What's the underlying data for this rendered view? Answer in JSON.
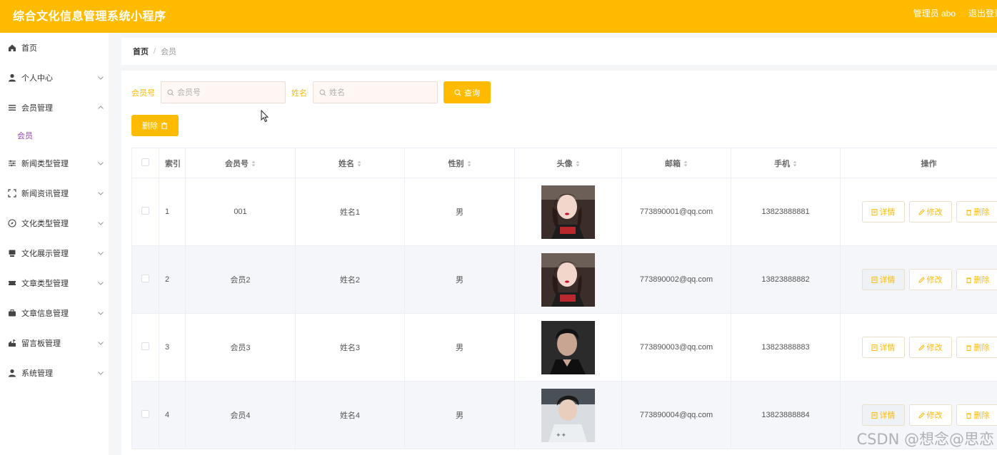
{
  "header": {
    "app_title": "综合文化信息管理系统小程序",
    "admin_label": "管理员 abo",
    "logout_label": "退出登录"
  },
  "sidebar": {
    "items": [
      {
        "label": "首页",
        "icon": "home-icon",
        "expandable": false
      },
      {
        "label": "个人中心",
        "icon": "user-icon",
        "expandable": true
      },
      {
        "label": "会员管理",
        "icon": "menu-lines-icon",
        "expandable": true,
        "expanded": true,
        "children": [
          "会员"
        ]
      },
      {
        "label": "新闻类型管理",
        "icon": "sliders-icon",
        "expandable": true
      },
      {
        "label": "新闻资讯管理",
        "icon": "frame-icon",
        "expandable": true
      },
      {
        "label": "文化类型管理",
        "icon": "compass-icon",
        "expandable": true
      },
      {
        "label": "文化展示管理",
        "icon": "monitor-icon",
        "expandable": true
      },
      {
        "label": "文章类型管理",
        "icon": "ticket-icon",
        "expandable": true
      },
      {
        "label": "文章信息管理",
        "icon": "briefcase-icon",
        "expandable": true
      },
      {
        "label": "留言板管理",
        "icon": "house-flag-icon",
        "expandable": true
      },
      {
        "label": "系统管理",
        "icon": "user-icon",
        "expandable": true
      }
    ]
  },
  "breadcrumb": {
    "home": "首页",
    "separator": "/",
    "current": "会员"
  },
  "search": {
    "member_no_label": "会员号",
    "member_no_placeholder": "会员号",
    "member_no_value": "",
    "name_label": "姓名",
    "name_placeholder": "姓名",
    "name_value": "",
    "query_label": "查询",
    "delete_label": "删除"
  },
  "table": {
    "columns": [
      "索引",
      "会员号",
      "姓名",
      "性别",
      "头像",
      "邮箱",
      "手机",
      "操作"
    ],
    "rows": [
      {
        "index": "1",
        "member_no": "001",
        "name": "姓名1",
        "gender": "男",
        "avatar": "woman-portrait",
        "email": "773890001@qq.com",
        "phone": "13823888881"
      },
      {
        "index": "2",
        "member_no": "会员2",
        "name": "姓名2",
        "gender": "男",
        "avatar": "woman-portrait",
        "email": "773890002@qq.com",
        "phone": "13823888882"
      },
      {
        "index": "3",
        "member_no": "会员3",
        "name": "姓名3",
        "gender": "男",
        "avatar": "man-dark-portrait",
        "email": "773890003@qq.com",
        "phone": "13823888883"
      },
      {
        "index": "4",
        "member_no": "会员4",
        "name": "姓名4",
        "gender": "男",
        "avatar": "man-light-portrait",
        "email": "773890004@qq.com",
        "phone": "13823888884"
      }
    ],
    "actions": {
      "detail": "详情",
      "edit": "修改",
      "delete": "删除"
    }
  },
  "watermark": "CSDN @想念@思恋",
  "colors": {
    "accent": "#ffbb00",
    "submenu_active": "#9b3fb0"
  }
}
